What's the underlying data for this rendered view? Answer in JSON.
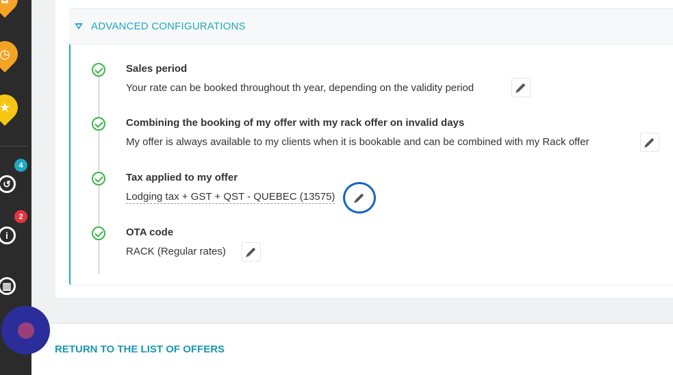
{
  "sidebar": {
    "pins": [
      {
        "icon": "orange-pin-icon",
        "color": "#f4a324"
      },
      {
        "icon": "clock-pin-icon",
        "color": "#f4a324"
      },
      {
        "icon": "star-pin-icon",
        "color": "#f7c613"
      }
    ],
    "history_badge": "4",
    "info_badge": "2"
  },
  "advanced": {
    "title": "ADVANCED CONFIGURATIONS",
    "steps": [
      {
        "title": "Sales period",
        "desc": "Your rate can be booked throughout th year, depending on the validity period"
      },
      {
        "title": "Combining the booking of my offer with my rack offer on invalid days",
        "desc": "My offer is always available to my clients when it is bookable and can be combined with my Rack offer"
      },
      {
        "title": "Tax applied to my offer",
        "desc": "Lodging tax + GST + QST - QUEBEC (13575)"
      },
      {
        "title": "OTA code",
        "desc": "RACK (Regular rates)"
      }
    ]
  },
  "footer": {
    "return_label": "RETURN TO THE LIST OF OFFERS"
  },
  "colors": {
    "accent": "#1ea9bf",
    "check": "#3bb44a",
    "highlight_ring": "#1565c0",
    "chat": "#2b2d9a"
  }
}
